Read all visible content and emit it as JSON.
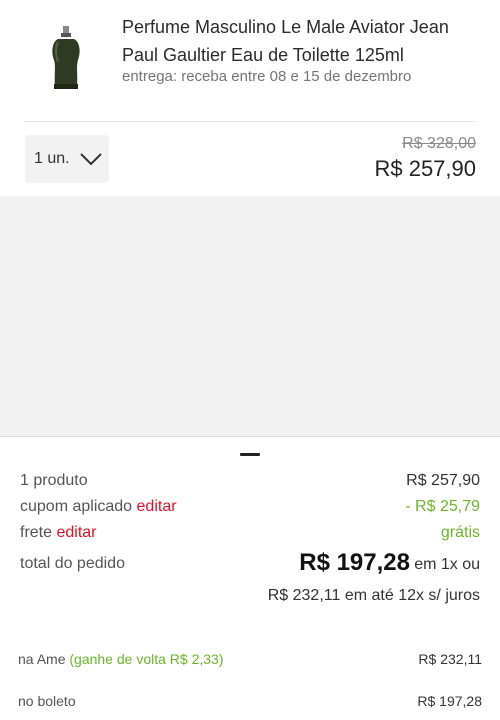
{
  "product": {
    "title": "Perfume Masculino Le Male Aviator Jean Paul Gaultier Eau de Toilette 125ml",
    "delivery": "entrega: receba entre 08 e 15 de dezembro",
    "quantity": "1 un.",
    "old_price": "R$ 328,00",
    "new_price": "R$ 257,90"
  },
  "summary": {
    "products_label": "1 produto",
    "products_value": "R$ 257,90",
    "coupon_label": "cupom aplicado",
    "coupon_edit": "editar",
    "coupon_value": "- R$ 25,79",
    "shipping_label": "frete",
    "shipping_edit": "editar",
    "shipping_value": "grátis",
    "total_label": "total do pedido",
    "total_value": "R$ 197,28",
    "total_suffix": "em 1x ou",
    "installments": "R$ 232,11 em até 12x s/ juros"
  },
  "payment": {
    "ame_label": "na Ame",
    "ame_cashback": "(ganhe de volta R$ 2,33)",
    "ame_value": "R$ 232,11",
    "boleto_label": "no boleto",
    "boleto_value": "R$ 197,28"
  },
  "colors": {
    "discount_green": "#6ab52b",
    "edit_red": "#e0102a"
  }
}
